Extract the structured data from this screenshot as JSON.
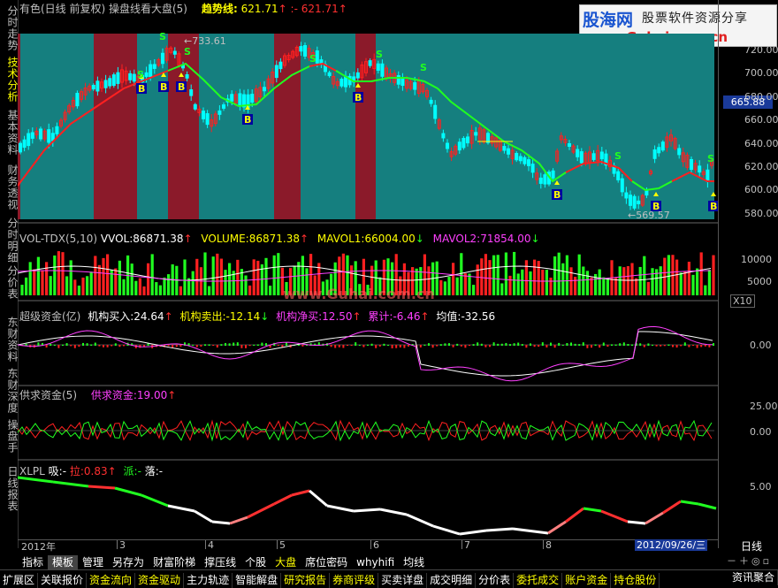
{
  "colors": {
    "teal": "#157F7F",
    "maroon": "#8B1A2A",
    "red": "#ff2020",
    "green": "#20ff20",
    "yellow": "#ffff00",
    "magenta": "#ff40ff",
    "cyan": "#00ffff",
    "white": "#ffffff"
  },
  "header": {
    "title": "有色(日线 前复权) 操盘线看大盘(5)",
    "trend_label": "趋势线:",
    "trend_value": "621.71",
    "trend_sep": ":-",
    "trend_value2": "621.71"
  },
  "watermark": {
    "brand": "股海网",
    "domain": "www.Guhai.com.cn",
    "slogan": "股票软件资源分享"
  },
  "sidebar": [
    "分时走势",
    "技术分析",
    "基本资料",
    "财务透视",
    "分时明细",
    "分价表",
    "东财资料",
    "东财深度",
    "操盘手",
    "日线报表"
  ],
  "price_axis": [
    "720.00",
    "700.00",
    "680.00",
    "660.00",
    "640.00",
    "620.00",
    "600.00",
    "580.00"
  ],
  "price_tag": "665.88",
  "price_annot": {
    "high": "733.61",
    "low": "569.57",
    "small": "15"
  },
  "vol_panel": {
    "title": "VOL-TDX(5,10)",
    "vvol_label": "VVOL:",
    "vvol_value": "86871.38",
    "volume_label": "VOLUME:",
    "volume_value": "86871.38",
    "mavol1_label": "MAVOL1:",
    "mavol1_value": "66004.00",
    "mavol2_label": "MAVOL2:",
    "mavol2_value": "71854.00",
    "axis": [
      "10000",
      "5000"
    ],
    "unit": "X10"
  },
  "fund_panel": {
    "title": "超级资金(亿)",
    "buy_label": "机构买入:",
    "buy_value": "24.64",
    "sell_label": "机构卖出:",
    "sell_value": "-12.14",
    "net_label": "机构净买:",
    "net_value": "12.50",
    "cum_label": "累计:",
    "cum_value": "-6.46",
    "avg_label": "均值:",
    "avg_value": "-32.56",
    "axis": [
      "0.00"
    ]
  },
  "supply_panel": {
    "title": "供求资金(5)",
    "label": "供求资金:",
    "value": "19.00",
    "axis": [
      "25.00",
      "0.00"
    ]
  },
  "xlpl_panel": {
    "title": "XLPL",
    "xi_label": "吸:",
    "xi_value": "-",
    "la_label": "拉:",
    "la_value": "0.83",
    "pai_label": "派:",
    "pai_value": "-",
    "luo_label": "落:",
    "luo_value": "-",
    "axis": [
      "5.00"
    ]
  },
  "date_axis": {
    "year": "2012年",
    "months": [
      "3",
      "4",
      "5",
      "6",
      "7",
      "8"
    ],
    "cursor_date": "2012/09/26/三",
    "period": "日线"
  },
  "bottom_tabs": [
    "指标",
    "模板",
    "管理",
    "另存为",
    "财富阶梯",
    "撑压线",
    "个股",
    "大盘",
    "席位密码",
    "whyhifi",
    "均线"
  ],
  "function_bar": [
    "扩展区",
    "关联报价",
    "资金流向",
    "资金驱动",
    "主力轨迹",
    "智能解盘",
    "研究报告",
    "券商评级",
    "买卖详盘",
    "成交明细",
    "分价表",
    "委托成交",
    "账户资金",
    "持仓股份",
    "资讯聚合"
  ],
  "signals": {
    "buy": "B",
    "sell": "S"
  }
}
